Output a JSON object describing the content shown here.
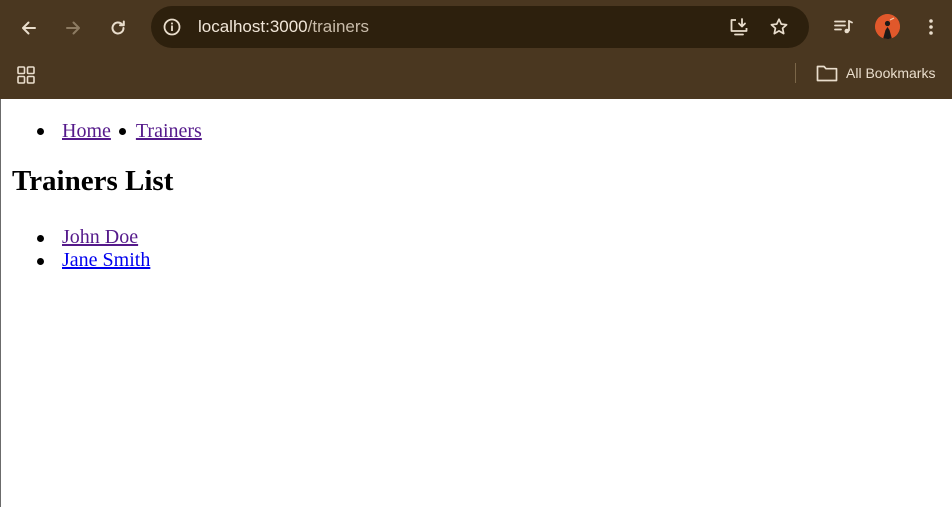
{
  "browser": {
    "url_host": "localhost:3000",
    "url_path": "/trainers",
    "bookmarks_label": "All Bookmarks",
    "icons": {
      "back": "arrow-left-icon",
      "forward": "arrow-right-icon",
      "reload": "reload-icon",
      "site_info": "info-icon",
      "install": "install-app-icon",
      "bookmark": "star-icon",
      "media": "media-queue-icon",
      "menu": "kebab-menu-icon",
      "apps": "apps-grid-icon",
      "folder": "folder-icon"
    },
    "colors": {
      "frame": "#4a3720",
      "omnibox": "#2d200d",
      "icon": "#e9ddcc",
      "avatar": "#e0582b"
    }
  },
  "page": {
    "nav": [
      {
        "label": "Home"
      },
      {
        "label": "Trainers"
      }
    ],
    "title": "Trainers List",
    "trainers": [
      {
        "name": "John Doe"
      },
      {
        "name": "Jane Smith"
      }
    ],
    "colors": {
      "link_visited": "#551a8b",
      "link_unvisited": "#0000ee"
    }
  }
}
